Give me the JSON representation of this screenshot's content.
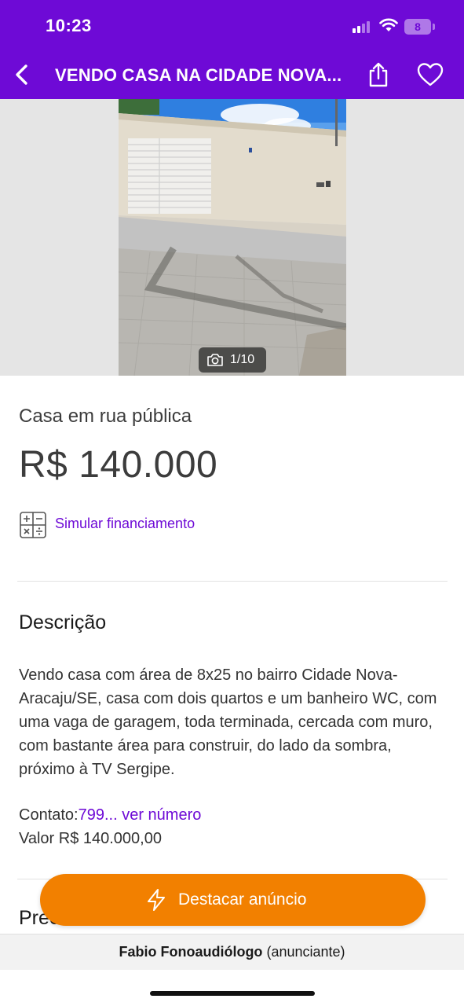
{
  "status_bar": {
    "time": "10:23",
    "battery": "8"
  },
  "header": {
    "title": "VENDO CASA NA CIDADE NOVA..."
  },
  "gallery": {
    "counter": "1/10"
  },
  "listing": {
    "subtitle": "Casa em rua pública",
    "price": "R$ 140.000",
    "simulate_label": "Simular financiamento"
  },
  "description": {
    "title": "Descrição",
    "body": "Vendo casa com área de 8x25 no bairro Cidade Nova-Aracaju/SE, casa com dois quartos e um banheiro WC, com uma vaga de garagem, toda terminada, cercada com muro, com bastante área para construir, do lado da sombra, próximo à TV Sergipe.",
    "contact_prefix": "Contato:",
    "contact_link": "799... ver número",
    "value_line": "Valor R$ 140.000,00"
  },
  "next_section": {
    "partial_title": "Precisa anunciar?"
  },
  "highlight_button": {
    "label": "Destacar anúncio"
  },
  "advertiser": {
    "name": "Fabio Fonoaudiólogo",
    "role": "(anunciante)"
  },
  "colors": {
    "brand_purple": "#6e0ad6",
    "accent_orange": "#f28000"
  },
  "icons": [
    "back-arrow-icon",
    "share-icon",
    "heart-icon",
    "camera-icon",
    "calculator-icon",
    "lightning-bolt-icon"
  ]
}
